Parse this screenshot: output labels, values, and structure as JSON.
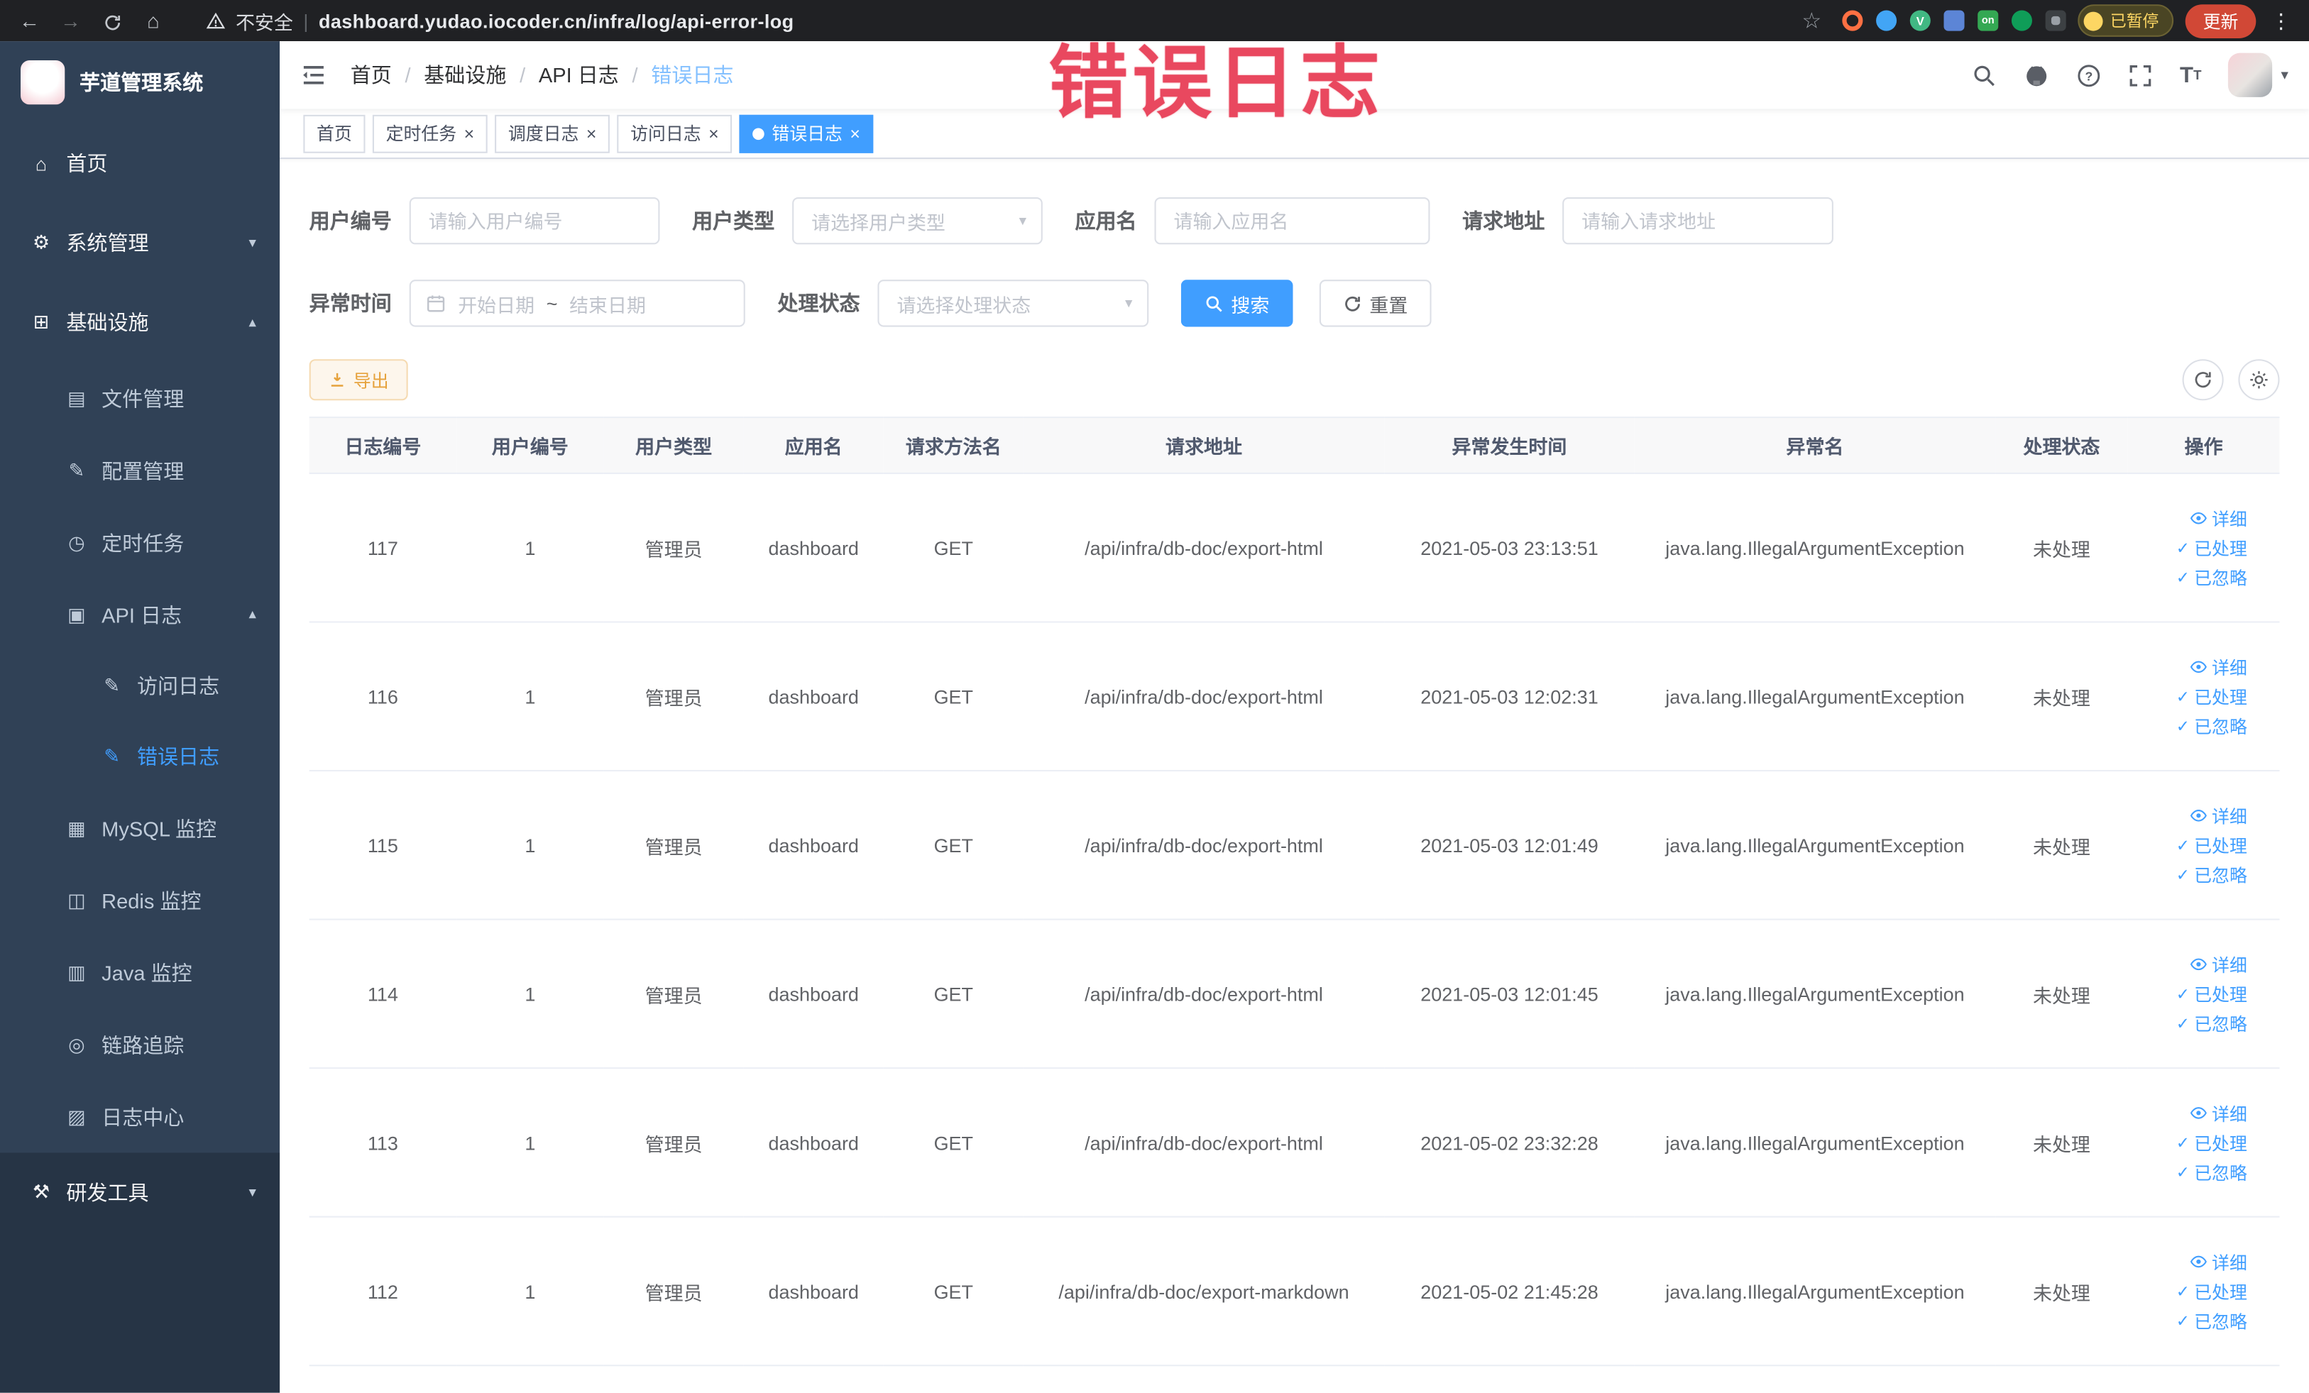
{
  "annotation": "错误日志",
  "browser": {
    "security_label": "不安全",
    "url": "dashboard.yudao.iocoder.cn/infra/log/api-error-log",
    "paused_badge": "已暂停",
    "update_button": "更新",
    "extension_on_badge": "on",
    "vue_badge": "V"
  },
  "sidebar": {
    "logo_title": "芋道管理系统",
    "items": [
      {
        "id": "home",
        "label": "首页",
        "icon": "home-icon",
        "depth": 0
      },
      {
        "id": "system-mgmt",
        "label": "系统管理",
        "icon": "gear-icon",
        "depth": 0,
        "chevron": "down"
      },
      {
        "id": "infrastructure",
        "label": "基础设施",
        "icon": "grid-icon",
        "depth": 0,
        "chevron": "up"
      },
      {
        "id": "file-mgmt",
        "label": "文件管理",
        "icon": "file-icon",
        "depth": 1
      },
      {
        "id": "config-mgmt",
        "label": "配置管理",
        "icon": "edit-icon",
        "depth": 1
      },
      {
        "id": "scheduled-jobs",
        "label": "定时任务",
        "icon": "clock-icon",
        "depth": 1
      },
      {
        "id": "api-log",
        "label": "API 日志",
        "icon": "log-icon",
        "depth": 1,
        "chevron": "up"
      },
      {
        "id": "access-log",
        "label": "访问日志",
        "icon": "doc-edit-icon",
        "depth": 2
      },
      {
        "id": "error-log",
        "label": "错误日志",
        "icon": "doc-edit-icon",
        "depth": 2,
        "active": true
      },
      {
        "id": "mysql-monitor",
        "label": "MySQL 监控",
        "icon": "database-icon",
        "depth": 1
      },
      {
        "id": "redis-monitor",
        "label": "Redis 监控",
        "icon": "database2-icon",
        "depth": 1
      },
      {
        "id": "java-monitor",
        "label": "Java 监控",
        "icon": "monitor-icon",
        "depth": 1
      },
      {
        "id": "trace",
        "label": "链路追踪",
        "icon": "link-icon",
        "depth": 1
      },
      {
        "id": "log-center",
        "label": "日志中心",
        "icon": "log-center-icon",
        "depth": 1
      },
      {
        "id": "dev-tools",
        "label": "研发工具",
        "icon": "tools-icon",
        "depth": 0,
        "chevron": "down",
        "dark": true
      }
    ]
  },
  "icon_glyphs": {
    "home-icon": "⌂",
    "gear-icon": "⚙",
    "grid-icon": "⊞",
    "file-icon": "▤",
    "edit-icon": "✎",
    "clock-icon": "◷",
    "log-icon": "▣",
    "doc-edit-icon": "✎",
    "database-icon": "▦",
    "database2-icon": "◫",
    "monitor-icon": "▥",
    "link-icon": "◎",
    "log-center-icon": "▨",
    "tools-icon": "⚒"
  },
  "header": {
    "breadcrumbs": [
      "首页",
      "基础设施",
      "API 日志",
      "错误日志"
    ]
  },
  "tags": [
    {
      "label": "首页",
      "closable": false,
      "active": false
    },
    {
      "label": "定时任务",
      "closable": true,
      "active": false
    },
    {
      "label": "调度日志",
      "closable": true,
      "active": false
    },
    {
      "label": "访问日志",
      "closable": true,
      "active": false
    },
    {
      "label": "错误日志",
      "closable": true,
      "active": true
    }
  ],
  "filters": {
    "user_id_label": "用户编号",
    "user_id_placeholder": "请输入用户编号",
    "user_type_label": "用户类型",
    "user_type_placeholder": "请选择用户类型",
    "app_name_label": "应用名",
    "app_name_placeholder": "请输入应用名",
    "request_url_label": "请求地址",
    "request_url_placeholder": "请输入请求地址",
    "exception_time_label": "异常时间",
    "date_start_placeholder": "开始日期",
    "date_separator": "~",
    "date_end_placeholder": "结束日期",
    "process_status_label": "处理状态",
    "process_status_placeholder": "请选择处理状态",
    "search_button": "搜索",
    "reset_button": "重置"
  },
  "toolbar": {
    "export_button": "导出"
  },
  "table": {
    "columns": [
      {
        "key": "log-id",
        "label": "日志编号"
      },
      {
        "key": "user-id",
        "label": "用户编号"
      },
      {
        "key": "user-type",
        "label": "用户类型"
      },
      {
        "key": "app-name",
        "label": "应用名"
      },
      {
        "key": "method-name",
        "label": "请求方法名"
      },
      {
        "key": "request-url",
        "label": "请求地址"
      },
      {
        "key": "exception-time",
        "label": "异常发生时间"
      },
      {
        "key": "exception-name",
        "label": "异常名"
      },
      {
        "key": "process-status",
        "label": "处理状态"
      },
      {
        "key": "actions",
        "label": "操作"
      }
    ],
    "rows": [
      [
        "117",
        "1",
        "管理员",
        "dashboard",
        "GET",
        "/api/infra/db-doc/export-html",
        "2021-05-03 23:13:51",
        "java.lang.IllegalArgumentException",
        "未处理"
      ],
      [
        "116",
        "1",
        "管理员",
        "dashboard",
        "GET",
        "/api/infra/db-doc/export-html",
        "2021-05-03 12:02:31",
        "java.lang.IllegalArgumentException",
        "未处理"
      ],
      [
        "115",
        "1",
        "管理员",
        "dashboard",
        "GET",
        "/api/infra/db-doc/export-html",
        "2021-05-03 12:01:49",
        "java.lang.IllegalArgumentException",
        "未处理"
      ],
      [
        "114",
        "1",
        "管理员",
        "dashboard",
        "GET",
        "/api/infra/db-doc/export-html",
        "2021-05-03 12:01:45",
        "java.lang.IllegalArgumentException",
        "未处理"
      ],
      [
        "113",
        "1",
        "管理员",
        "dashboard",
        "GET",
        "/api/infra/db-doc/export-html",
        "2021-05-02 23:32:28",
        "java.lang.IllegalArgumentException",
        "未处理"
      ],
      [
        "112",
        "1",
        "管理员",
        "dashboard",
        "GET",
        "/api/infra/db-doc/export-markdown",
        "2021-05-02 21:45:28",
        "java.lang.IllegalArgumentException",
        "未处理"
      ]
    ],
    "row_actions": [
      "详细",
      "已处理",
      "已忽略"
    ]
  }
}
